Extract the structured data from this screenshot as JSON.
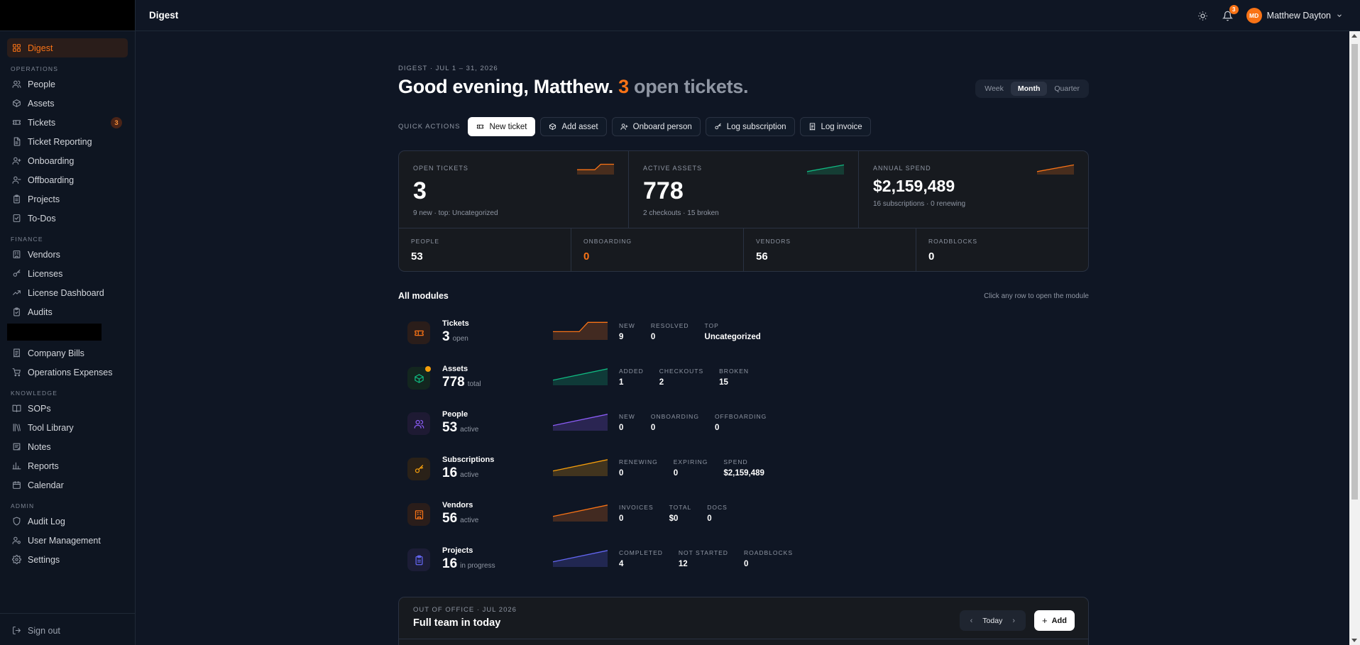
{
  "app": {
    "title": "Digest"
  },
  "sidebar": {
    "active": {
      "label": "Digest",
      "icon": "grid-icon"
    },
    "sections": [
      {
        "label": "OPERATIONS",
        "items": [
          {
            "label": "People",
            "icon": "users-icon"
          },
          {
            "label": "Assets",
            "icon": "box-icon"
          },
          {
            "label": "Tickets",
            "icon": "ticket-icon",
            "badge": "3"
          },
          {
            "label": "Ticket Reporting",
            "icon": "report-icon"
          },
          {
            "label": "Onboarding",
            "icon": "user-plus-icon"
          },
          {
            "label": "Offboarding",
            "icon": "user-minus-icon"
          },
          {
            "label": "Projects",
            "icon": "clipboard-icon"
          },
          {
            "label": "To-Dos",
            "icon": "checklist-icon"
          }
        ]
      },
      {
        "label": "FINANCE",
        "items": [
          {
            "label": "Vendors",
            "icon": "building-icon"
          },
          {
            "label": "Licenses",
            "icon": "key-icon"
          },
          {
            "label": "License Dashboard",
            "icon": "trend-icon"
          },
          {
            "label": "Audits",
            "icon": "clipboard-check-icon"
          }
        ]
      },
      {
        "label": "",
        "redacted": true,
        "items": [
          {
            "label": "Company Bills",
            "icon": "receipt-icon"
          },
          {
            "label": "Operations Expenses",
            "icon": "cart-icon"
          }
        ]
      },
      {
        "label": "KNOWLEDGE",
        "items": [
          {
            "label": "SOPs",
            "icon": "book-icon"
          },
          {
            "label": "Tool Library",
            "icon": "library-icon"
          },
          {
            "label": "Notes",
            "icon": "note-icon"
          },
          {
            "label": "Reports",
            "icon": "bar-chart-icon"
          },
          {
            "label": "Calendar",
            "icon": "calendar-icon"
          }
        ]
      },
      {
        "label": "ADMIN",
        "items": [
          {
            "label": "Audit Log",
            "icon": "shield-icon"
          },
          {
            "label": "User Management",
            "icon": "users-gear-icon"
          },
          {
            "label": "Settings",
            "icon": "gear-icon"
          }
        ]
      }
    ],
    "sign_out": "Sign out"
  },
  "topbar": {
    "title": "Digest",
    "bell_badge": "3",
    "user_initials": "MD",
    "user_name": "Matthew Dayton"
  },
  "digest": {
    "eyebrow": "DIGEST · JUL 1 – 31, 2026",
    "greeting_lead": "Good evening, Matthew.",
    "greeting_count": "3",
    "greeting_tail": "open tickets.",
    "periods": [
      "Week",
      "Month",
      "Quarter"
    ],
    "period_selected": "Month"
  },
  "quick_actions": {
    "label": "QUICK ACTIONS",
    "buttons": [
      {
        "label": "New ticket",
        "icon": "ticket-icon",
        "primary": true
      },
      {
        "label": "Add asset",
        "icon": "box-icon"
      },
      {
        "label": "Onboard person",
        "icon": "user-plus-icon"
      },
      {
        "label": "Log subscription",
        "icon": "key-icon"
      },
      {
        "label": "Log invoice",
        "icon": "receipt-icon"
      }
    ]
  },
  "stats": {
    "top": [
      {
        "label": "OPEN TICKETS",
        "value": "3",
        "sub": "9 new · top: Uncategorized",
        "color": "#f97316"
      },
      {
        "label": "ACTIVE ASSETS",
        "value": "778",
        "sub": "2 checkouts · 15 broken",
        "color": "#10b981"
      },
      {
        "label": "ANNUAL SPEND",
        "value": "$2,159,489",
        "sub": "16 subscriptions · 0 renewing",
        "color": "#f97316"
      }
    ],
    "bottom": [
      {
        "label": "PEOPLE",
        "value": "53"
      },
      {
        "label": "ONBOARDING",
        "value": "0"
      },
      {
        "label": "VENDORS",
        "value": "56"
      },
      {
        "label": "ROADBLOCKS",
        "value": "0"
      }
    ]
  },
  "modules": {
    "title": "All modules",
    "hint": "Click any row to open the module",
    "rows": [
      {
        "name": "Tickets",
        "count": "3",
        "unit": "open",
        "icon": "ticket-icon",
        "color": "#f97316",
        "bg": "#2a1d1a",
        "metrics": [
          {
            "label": "NEW",
            "value": "9"
          },
          {
            "label": "RESOLVED",
            "value": "0"
          },
          {
            "label": "TOP",
            "value": "Uncategorized"
          }
        ]
      },
      {
        "name": "Assets",
        "count": "778",
        "unit": "total",
        "icon": "box-icon",
        "color": "#10b981",
        "bg": "#13261f",
        "dot": true,
        "metrics": [
          {
            "label": "ADDED",
            "value": "1"
          },
          {
            "label": "CHECKOUTS",
            "value": "2"
          },
          {
            "label": "BROKEN",
            "value": "15"
          }
        ]
      },
      {
        "name": "People",
        "count": "53",
        "unit": "active",
        "icon": "users-icon",
        "color": "#8b5cf6",
        "bg": "#1e1a33",
        "metrics": [
          {
            "label": "NEW",
            "value": "0"
          },
          {
            "label": "ONBOARDING",
            "value": "0"
          },
          {
            "label": "OFFBOARDING",
            "value": "0"
          }
        ]
      },
      {
        "name": "Subscriptions",
        "count": "16",
        "unit": "active",
        "icon": "key-icon",
        "color": "#f59e0b",
        "bg": "#2a2118",
        "metrics": [
          {
            "label": "RENEWING",
            "value": "0"
          },
          {
            "label": "EXPIRING",
            "value": "0"
          },
          {
            "label": "SPEND",
            "value": "$2,159,489"
          }
        ]
      },
      {
        "name": "Vendors",
        "count": "56",
        "unit": "active",
        "icon": "building-icon",
        "color": "#f97316",
        "bg": "#2a1d1a",
        "metrics": [
          {
            "label": "INVOICES",
            "value": "0"
          },
          {
            "label": "TOTAL",
            "value": "$0"
          },
          {
            "label": "DOCS",
            "value": "0"
          }
        ]
      },
      {
        "name": "Projects",
        "count": "16",
        "unit": "in progress",
        "icon": "clipboard-icon",
        "color": "#6366f1",
        "bg": "#1c1d36",
        "metrics": [
          {
            "label": "COMPLETED",
            "value": "4"
          },
          {
            "label": "NOT STARTED",
            "value": "12"
          },
          {
            "label": "ROADBLOCKS",
            "value": "0"
          }
        ]
      }
    ]
  },
  "out_of_office": {
    "label": "OUT OF OFFICE · JUL 2026",
    "title": "Full team in today",
    "today": "Today",
    "add": "Add"
  }
}
